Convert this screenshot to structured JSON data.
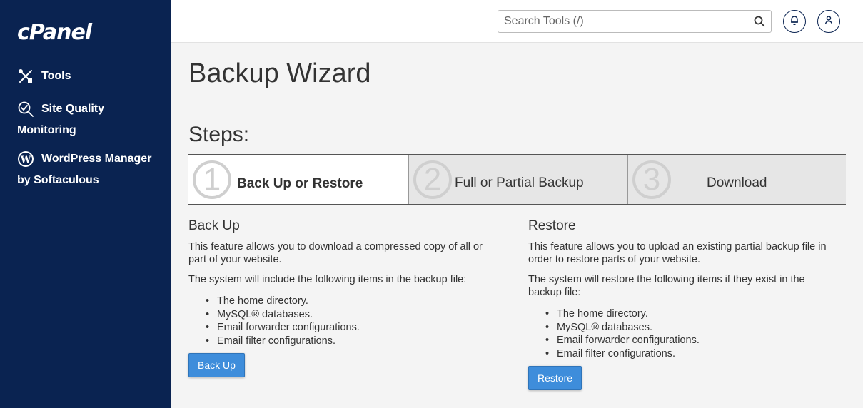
{
  "app": {
    "logo": "cPanel"
  },
  "sidebar": {
    "items": [
      {
        "label": "Tools",
        "icon": "tools-icon"
      },
      {
        "label_line1": "Site Quality",
        "label_line2": "Monitoring",
        "icon": "site-quality-icon"
      },
      {
        "label_line1": "WordPress Manager",
        "label_line2": "by Softaculous",
        "icon": "wordpress-icon"
      }
    ]
  },
  "header": {
    "search_placeholder": "Search Tools (/)"
  },
  "main": {
    "title": "Backup Wizard",
    "steps_title": "Steps:",
    "steps": [
      {
        "num": "1",
        "label": "Back Up or Restore",
        "active": true
      },
      {
        "num": "2",
        "label": "Full or Partial Backup",
        "active": false
      },
      {
        "num": "3",
        "label": "Download",
        "active": false
      }
    ],
    "backup": {
      "heading": "Back Up",
      "desc": "This feature allows you to download a compressed copy of all or part of your website.",
      "intro": "The system will include the following items in the backup file:",
      "items": [
        "The home directory.",
        "MySQL® databases.",
        "Email forwarder configurations.",
        "Email filter configurations."
      ],
      "button": "Back Up"
    },
    "restore": {
      "heading": "Restore",
      "desc": "This feature allows you to upload an existing partial backup file in order to restore parts of your website.",
      "intro": "The system will restore the following items if they exist in the backup file:",
      "items": [
        "The home directory.",
        "MySQL® databases.",
        "Email forwarder configurations.",
        "Email filter configurations."
      ],
      "button": "Restore"
    }
  },
  "colors": {
    "sidebar_bg": "#0a2351",
    "accent": "#3e8ddb"
  }
}
